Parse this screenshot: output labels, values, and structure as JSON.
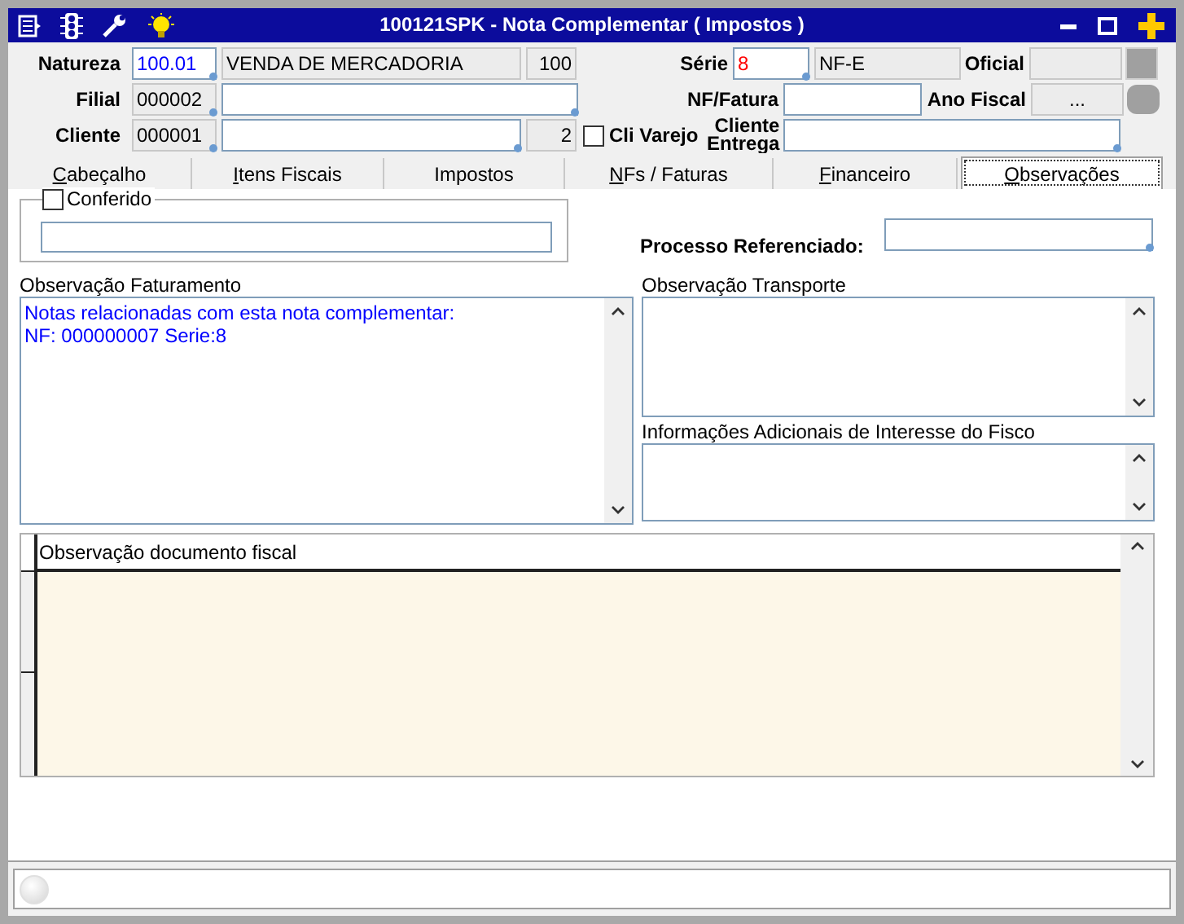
{
  "window": {
    "title": "100121SPK - Nota Complementar ( Impostos )"
  },
  "header_rows": [
    {
      "items": [
        {
          "kind": "label",
          "text": "Natureza"
        },
        {
          "kind": "field",
          "value": "100.01",
          "readonly": false,
          "lookup": true,
          "color": "#0000ff"
        },
        {
          "kind": "field",
          "value": "VENDA DE MERCADORIA",
          "readonly": true,
          "lookup": false
        },
        {
          "kind": "field",
          "value": "100",
          "readonly": true,
          "lookup": false
        },
        {
          "kind": "label",
          "text": "Série"
        },
        {
          "kind": "field",
          "value": "8",
          "readonly": false,
          "lookup": true,
          "color": "#ff0000"
        },
        {
          "kind": "field",
          "value": "NF-E",
          "readonly": true,
          "lookup": false
        },
        {
          "kind": "label",
          "text": "Oficial"
        },
        {
          "kind": "field",
          "readonly": true,
          "lookup": false
        }
      ]
    },
    {
      "items": [
        {
          "kind": "label",
          "text": "Filial"
        },
        {
          "kind": "field",
          "value": "000002",
          "readonly": true,
          "lookup": true
        },
        {
          "kind": "field",
          "readonly": false,
          "lookup": true
        },
        {
          "kind": "label",
          "text": "NF/Fatura"
        },
        {
          "kind": "field",
          "readonly": false,
          "lookup": false
        },
        {
          "kind": "label",
          "text": "Ano Fiscal"
        },
        {
          "kind": "field",
          "value": "...",
          "readonly": true,
          "lookup": false
        }
      ]
    },
    {
      "items": [
        {
          "kind": "label",
          "text": "Cliente"
        },
        {
          "kind": "field",
          "value": "000001",
          "readonly": true,
          "lookup": true
        },
        {
          "kind": "field",
          "readonly": false,
          "lookup": true
        },
        {
          "kind": "field",
          "value": "2",
          "readonly": true,
          "lookup": false
        },
        {
          "kind": "checkbox",
          "label": "Cli Varejo",
          "checked": false
        },
        {
          "kind": "label",
          "text": "Cliente Entrega"
        },
        {
          "kind": "field",
          "readonly": false,
          "lookup": true
        }
      ]
    }
  ],
  "tabs": [
    {
      "label": "Cabeçalho",
      "selected": false,
      "mnemonic": true
    },
    {
      "label": "Itens Fiscais",
      "selected": false,
      "mnemonic": true
    },
    {
      "label": "Impostos",
      "selected": false,
      "mnemonic": false
    },
    {
      "label": "NFs / Faturas",
      "selected": false,
      "mnemonic": true
    },
    {
      "label": "Financeiro",
      "selected": false,
      "mnemonic": true
    },
    {
      "label": "Observações",
      "selected": true,
      "mnemonic": true
    }
  ],
  "conferido": {
    "label": "Conferido",
    "checked": false
  },
  "processo_referenciado": {
    "label": "Processo Referenciado:"
  },
  "observacao_faturamento": {
    "label": "Observação Faturamento",
    "lines": [
      "Notas relacionadas com esta nota complementar:",
      "NF: 000000007 Serie:8"
    ]
  },
  "observacao_transporte": {
    "label": "Observação Transporte"
  },
  "informacoes_adicionais": {
    "label": "Informações Adicionais de Interesse do Fisco"
  },
  "documento_fiscal_grid": {
    "column": "Observação documento fiscal"
  }
}
